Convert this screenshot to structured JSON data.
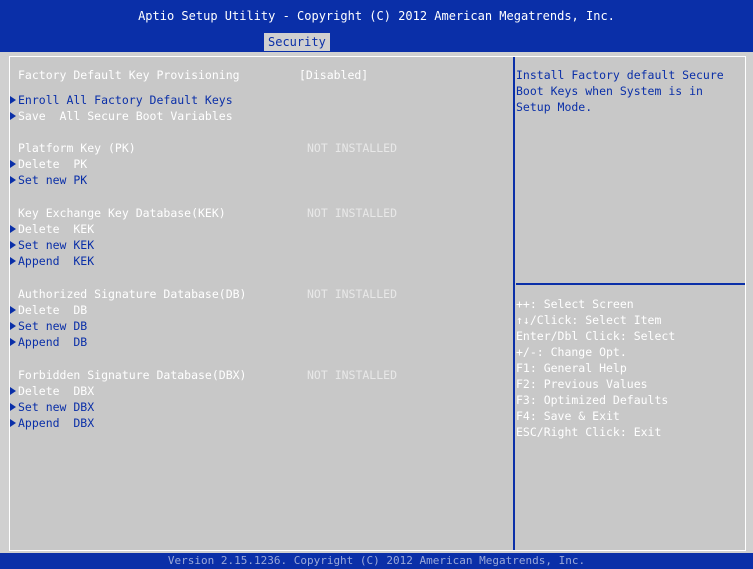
{
  "header": {
    "title": "Aptio Setup Utility - Copyright (C) 2012 American Megatrends, Inc.",
    "active_tab": "Security"
  },
  "menu": {
    "factory_default": {
      "label": "Factory Default Key Provisioning",
      "value": "[Disabled]"
    },
    "enroll_all": "Enroll All Factory Default Keys",
    "save_all": "Save  All Secure Boot Variables",
    "pk": {
      "label": "Platform Key (PK)",
      "status": "NOT INSTALLED",
      "delete": "Delete  PK",
      "set_new": "Set new PK"
    },
    "kek": {
      "label": "Key Exchange Key Database(KEK)",
      "status": "NOT INSTALLED",
      "delete": "Delete  KEK",
      "set_new": "Set new KEK",
      "append": "Append  KEK"
    },
    "db": {
      "label": "Authorized Signature Database(DB)",
      "status": "NOT INSTALLED",
      "delete": "Delete  DB",
      "set_new": "Set new DB",
      "append": "Append  DB"
    },
    "dbx": {
      "label": "Forbidden Signature Database(DBX)",
      "status": "NOT INSTALLED",
      "delete": "Delete  DBX",
      "set_new": "Set new DBX",
      "append": "Append  DBX"
    }
  },
  "help": {
    "lines": [
      "Install Factory default Secure",
      "Boot Keys when System is in",
      "Setup Mode."
    ]
  },
  "keys": [
    "++: Select Screen",
    "↑↓/Click: Select Item",
    "Enter/Dbl Click: Select",
    "+/-: Change Opt.",
    "F1: General Help",
    "F2: Previous Values",
    "F3: Optimized Defaults",
    "F4: Save & Exit",
    "ESC/Right Click: Exit"
  ],
  "footer": {
    "text": "Version 2.15.1236. Copyright (C) 2012 American Megatrends, Inc."
  },
  "colors": {
    "bios_blue": "#0a2fa8",
    "panel_gray": "#c8c8c8",
    "text_white": "#ffffff"
  }
}
